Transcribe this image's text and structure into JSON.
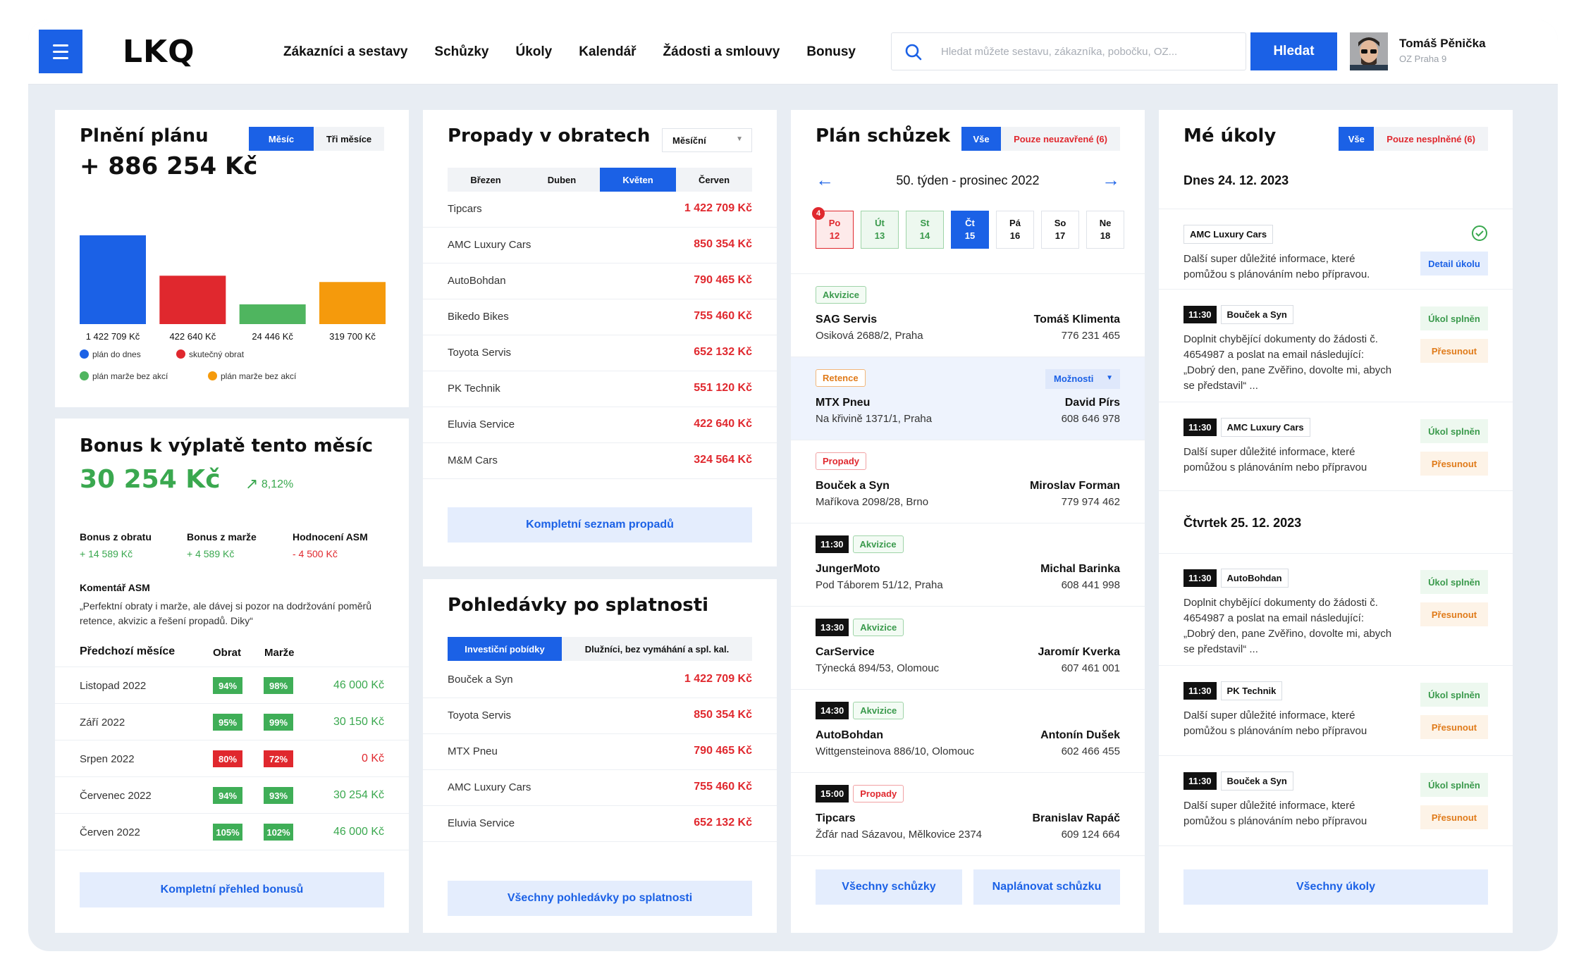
{
  "header": {
    "logo": "LKQ",
    "nav": [
      "Zákazníci a sestavy",
      "Schůzky",
      "Úkoly",
      "Kalendář",
      "Žádosti a smlouvy",
      "Bonusy"
    ],
    "search_placeholder": "Hledat můžete sestavu, zákazníka, pobočku, OZ...",
    "search_button": "Hledat",
    "user_name": "Tomáš Pěnička",
    "user_branch": "OZ Praha 9"
  },
  "plan": {
    "title": "Plnění plánu",
    "tabs": [
      "Měsíc",
      "Tři měsíce"
    ],
    "total": "+ 886 254 Kč",
    "legend": [
      "plán do dnes",
      "skutečný obrat",
      "plán marže bez akcí",
      "plán marže bez akcí"
    ],
    "chart_data": {
      "type": "bar",
      "categories": [
        "plán do dnes",
        "skutečný obrat",
        "plán marže bez akcí",
        "plán marže bez akcí"
      ],
      "values": [
        1422709,
        422640,
        24446,
        319700
      ],
      "labels": [
        "1 422 709 Kč",
        "422 640 Kč",
        "24 446 Kč",
        "319 700 Kč"
      ],
      "colors": [
        "#1b61e6",
        "#e0282e",
        "#4fb55f",
        "#f59a0c"
      ]
    }
  },
  "bonus": {
    "title": "Bonus k výplatě tento měsíc",
    "amount": "30 254 Kč",
    "change": "8,12%",
    "cols": [
      {
        "label": "Bonus z obratu",
        "value": "+ 14 589 Kč"
      },
      {
        "label": "Bonus z marže",
        "value": "+ 4 589 Kč"
      },
      {
        "label": "Hodnocení ASM",
        "value": "- 4 500 Kč"
      }
    ],
    "comment_title": "Komentář ASM",
    "comment": "„Perfektní obraty i marže, ale dávej si pozor na dodržování poměrů retence, akvizic a řešení propadů. Diky“",
    "prev_header": [
      "Předchozí měsíce",
      "Obrat",
      "Marže"
    ],
    "prev": [
      {
        "m": "Listopad 2022",
        "o": "94%",
        "oc": "g",
        "ma": "98%",
        "mc": "g",
        "b": "46 000 Kč",
        "bc": "g"
      },
      {
        "m": "Září 2022",
        "o": "95%",
        "oc": "g",
        "ma": "99%",
        "mc": "g",
        "b": "30 150 Kč",
        "bc": "g"
      },
      {
        "m": "Srpen 2022",
        "o": "80%",
        "oc": "r",
        "ma": "72%",
        "mc": "r",
        "b": "0 Kč",
        "bc": "r"
      },
      {
        "m": "Červenec 2022",
        "o": "94%",
        "oc": "g",
        "ma": "93%",
        "mc": "g",
        "b": "30 254 Kč",
        "bc": "g"
      },
      {
        "m": "Červen 2022",
        "o": "105%",
        "oc": "g",
        "ma": "102%",
        "mc": "g",
        "b": "46 000 Kč",
        "bc": "g"
      }
    ],
    "button": "Kompletní přehled bonusů"
  },
  "drops": {
    "title": "Propady v obratech",
    "select": "Měsíční",
    "months": [
      "Březen",
      "Duben",
      "Květen",
      "Červen"
    ],
    "rows": [
      [
        "Tipcars",
        "1 422 709 Kč"
      ],
      [
        "AMC Luxury Cars",
        "850 354 Kč"
      ],
      [
        "AutoBohdan",
        "790 465 Kč"
      ],
      [
        "Bikedo Bikes",
        "755 460 Kč"
      ],
      [
        "Toyota Servis",
        "652 132 Kč"
      ],
      [
        "PK Technik",
        "551 120 Kč"
      ],
      [
        "Eluvia Service",
        "422 640 Kč"
      ],
      [
        "M&M Cars",
        "324 564 Kč"
      ]
    ],
    "button": "Kompletní seznam propadů"
  },
  "overdue": {
    "title": "Pohledávky po splatnosti",
    "tabs": [
      "Investiční pobídky",
      "Dlužníci, bez vymáhání a spl. kal."
    ],
    "rows": [
      [
        "Bouček a Syn",
        "1 422 709 Kč"
      ],
      [
        "Toyota Servis",
        "850 354 Kč"
      ],
      [
        "MTX Pneu",
        "790 465 Kč"
      ],
      [
        "AMC Luxury Cars",
        "755 460 Kč"
      ],
      [
        "Eluvia Service",
        "652 132 Kč"
      ]
    ],
    "button": "Všechny pohledávky po splatnosti"
  },
  "meetings": {
    "title": "Plán schůzek",
    "tabs": [
      "Vše",
      "Pouze neuzavřené (6)"
    ],
    "week": "50. týden - prosinec 2022",
    "badge": "4",
    "days": [
      {
        "d": "Po",
        "n": "12",
        "s": "red"
      },
      {
        "d": "Út",
        "n": "13",
        "s": "green"
      },
      {
        "d": "St",
        "n": "14",
        "s": "green"
      },
      {
        "d": "Čt",
        "n": "15",
        "s": "blue"
      },
      {
        "d": "Pá",
        "n": "16",
        "s": ""
      },
      {
        "d": "So",
        "n": "17",
        "s": ""
      },
      {
        "d": "Ne",
        "n": "18",
        "s": ""
      }
    ],
    "options": "Možnosti",
    "items": [
      {
        "time": "",
        "tag": "Akvizice",
        "tc": "g",
        "name": "SAG Servis",
        "addr": "Osiková 2688/2, Praha",
        "contact": "Tomáš Klimenta",
        "phone": "776 231 465"
      },
      {
        "time": "",
        "tag": "Retence",
        "tc": "o",
        "name": "MTX Pneu",
        "addr": "Na křivině 1371/1, Praha",
        "contact": "David Pírs",
        "phone": "608 646 978"
      },
      {
        "time": "",
        "tag": "Propady",
        "tc": "r",
        "name": "Bouček a Syn",
        "addr": "Maříkova 2098/28, Brno",
        "contact": "Miroslav Forman",
        "phone": "779 974 462"
      },
      {
        "time": "11:30",
        "tag": "Akvizice",
        "tc": "g",
        "name": "JungerMoto",
        "addr": "Pod Táborem 51/12, Praha",
        "contact": "Michal Barinka",
        "phone": "608 441 998"
      },
      {
        "time": "13:30",
        "tag": "Akvizice",
        "tc": "g",
        "name": "CarService",
        "addr": "Týnecká 894/53, Olomouc",
        "contact": "Jaromír Kverka",
        "phone": "607 461 001"
      },
      {
        "time": "14:30",
        "tag": "Akvizice",
        "tc": "g",
        "name": "AutoBohdan",
        "addr": "Wittgensteinova 886/10, Olomouc",
        "contact": "Antonín Dušek",
        "phone": "602 466 455"
      },
      {
        "time": "15:00",
        "tag": "Propady",
        "tc": "r",
        "name": "Tipcars",
        "addr": "Žďár nad Sázavou, Mělkovice 2374",
        "contact": "Branislav Rapáč",
        "phone": "609 124 664"
      }
    ],
    "btn_all": "Všechny schůzky",
    "btn_plan": "Naplánovat schůzku"
  },
  "tasks": {
    "title": "Mé úkoly",
    "tabs": [
      "Vše",
      "Pouze nesplněné (6)"
    ],
    "day1": "Dnes 24. 12. 2023",
    "day2": "Čtvrtek 25. 12. 2023",
    "done": "Úkol splněn",
    "move": "Přesunout",
    "detail": "Detail úkolu",
    "items": [
      {
        "time": "",
        "firm": "AMC Luxury Cars",
        "text": "Další super důležité informace, které pomůžou s plánováním nebo přípravou."
      },
      {
        "time": "11:30",
        "firm": "Bouček a Syn",
        "text": "Doplnit chybějící dokumenty do žádosti č. 4654987 a poslat na email následující: „Dobrý den, pane Zvěřino, dovolte mi, abych se představil“ ..."
      },
      {
        "time": "11:30",
        "firm": "AMC Luxury Cars",
        "text": "Další super důležité informace, které pomůžou s plánováním nebo přípravou"
      },
      {
        "time": "11:30",
        "firm": "AutoBohdan",
        "text": "Doplnit chybějící dokumenty do žádosti č. 4654987 a poslat na email následující: „Dobrý den, pane Zvěřino, dovolte mi, abych se představil“ ..."
      },
      {
        "time": "11:30",
        "firm": "PK Technik",
        "text": "Další super důležité informace, které pomůžou s plánováním nebo přípravou"
      },
      {
        "time": "11:30",
        "firm": "Bouček a Syn",
        "text": "Další super důležité informace, které pomůžou s plánováním nebo přípravou"
      }
    ],
    "button": "Všechny úkoly"
  }
}
